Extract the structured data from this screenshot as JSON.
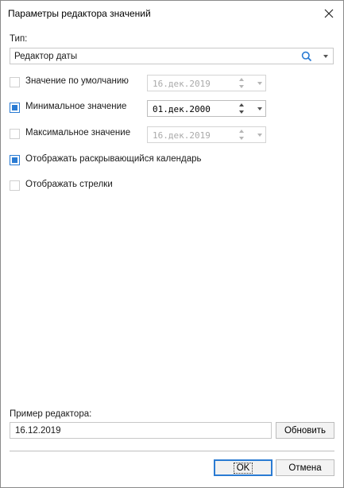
{
  "window": {
    "title": "Параметры редактора значений"
  },
  "type_section": {
    "label": "Тип:",
    "value": "Редактор даты"
  },
  "options": {
    "default_value": {
      "label": "Значение по умолчанию",
      "checked": false,
      "date": "16.дек.2019"
    },
    "min_value": {
      "label": "Минимальное значение",
      "checked": true,
      "date": "01.дек.2000"
    },
    "max_value": {
      "label": "Максимальное значение",
      "checked": false,
      "date": "16.дек.2019"
    },
    "show_calendar": {
      "label": "Отображать раскрывающийся календарь",
      "checked": true
    },
    "show_arrows": {
      "label": "Отображать стрелки",
      "checked": false
    }
  },
  "example": {
    "label": "Пример редактора:",
    "value": "16.12.2019",
    "refresh_label": "Обновить"
  },
  "buttons": {
    "ok_label": "OK",
    "cancel_label": "Отмена"
  },
  "colors": {
    "accent": "#2a7bd3"
  },
  "icons": {
    "close": "close-icon",
    "search": "search-icon",
    "dropdown": "chevron-down-icon"
  }
}
